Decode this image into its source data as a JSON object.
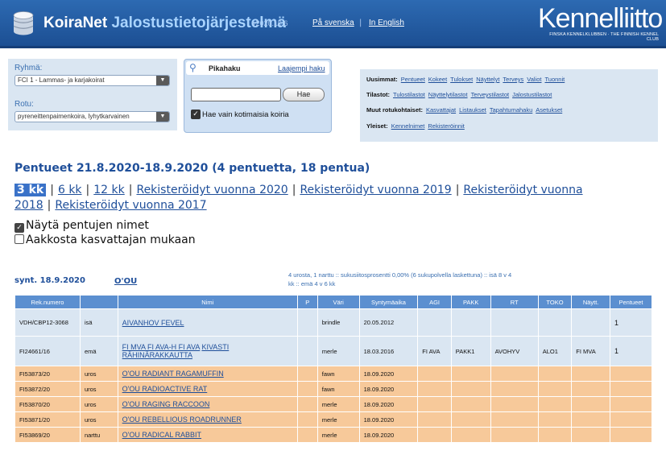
{
  "header": {
    "app_name": "KoiraNet",
    "app_subtitle": "Jalostustietojärjestelmä",
    "version": "v2020.10.6",
    "lang_swedish": "På svenska",
    "lang_separator": "|",
    "lang_english": "In English",
    "logo_text": "Kennelliitto",
    "logo_subtext": "FINSKA KENNELKLUBBEN · THE FINNISH KENNEL CLUB"
  },
  "filters": {
    "group_label": "Ryhmä:",
    "group_value": "FCI 1 - Lammas- ja karjakoirat",
    "breed_label": "Rotu:",
    "breed_value": "pyreneittenpaimenkoira, lyhytkarvainen"
  },
  "quick_search": {
    "title": "Pikahaku",
    "advanced_link": "Laajempi haku",
    "input_value": "",
    "button_label": "Hae",
    "checkbox_label": "Hae vain kotimaisia koiria"
  },
  "quick_links": {
    "rows": [
      {
        "label": "Uusimmat:",
        "links": [
          "Pentueet",
          "Kokeet",
          "Tulokset",
          "Näyttelyt",
          "Terveys",
          "Valiot",
          "Tuonnit"
        ]
      },
      {
        "label": "Tilastot:",
        "links": [
          "Tulostilastot",
          "Näyttelytilastot",
          "Terveystilastot",
          "Jalostustilastot"
        ]
      },
      {
        "label": "Muut rotukohtaiset:",
        "links": [
          "Kasvattajat",
          "Listaukset",
          "Tapahtumahaku",
          "Asetukset"
        ]
      },
      {
        "label": "Yleiset:",
        "links": [
          "Kennelnimet",
          "Rekisteröinnit"
        ]
      }
    ]
  },
  "page": {
    "title": "Pentueet 21.8.2020-18.9.2020 (4 pentuetta, 18 pentua)",
    "periods": [
      "3 kk",
      "6 kk",
      "12 kk",
      "Rekisteröidyt vuonna 2020",
      "Rekisteröidyt vuonna 2019",
      "Rekisteröidyt vuonna 2018",
      "Rekisteröidyt vuonna 2017"
    ],
    "period_separator": "|",
    "option_show_names": "Näytä pentujen nimet",
    "option_show_names_checked": true,
    "option_sort_breeder": "Aakkosta kasvattajan mukaan",
    "option_sort_breeder_checked": false
  },
  "litter": {
    "date": "synt. 18.9.2020",
    "kennel": "O'OU",
    "stats_line1": "4 urosta, 1 narttu  ::  sukusiitosprosentti 0,00% (6 sukupolvella laskettuna)  ::  isä 8 v 4",
    "stats_line2": "kk  ::  emä 4 v 6 kk",
    "columns": [
      "Rek.numero",
      "",
      "Nimi",
      "P",
      "Väri",
      "Syntymäaika",
      "AGI",
      "PAKK",
      "RT",
      "TOKO",
      "Näytt.",
      "Pentueet"
    ],
    "parents": [
      {
        "reg": "VDH/CBP12-3068",
        "role": "isä",
        "titles": "",
        "name": "AIVANHOV FEVEL",
        "p": "",
        "color": "brindle",
        "born": "20.05.2012",
        "agi": "",
        "pakk": "",
        "rt": "",
        "toko": "",
        "shows": "",
        "litters": "1"
      },
      {
        "reg": "FI24661/16",
        "role": "emä",
        "titles": "FI MVA FI AVA-H FI AVA",
        "name": "KIVASTI RÄHINÄRAKKAUTTA",
        "p": "",
        "color": "merle",
        "born": "18.03.2016",
        "agi": "FI AVA",
        "pakk": "PAKK1",
        "rt": "AVOHYV",
        "toko": "ALO1",
        "shows": "FI MVA",
        "litters": "1"
      }
    ],
    "puppies": [
      {
        "reg": "FI53873/20",
        "sex": "uros",
        "name": "O'OU RADIANT RAGAMUFFIN",
        "color": "fawn",
        "born": "18.09.2020"
      },
      {
        "reg": "FI53872/20",
        "sex": "uros",
        "name": "O'OU RADIOACTIVE RAT",
        "color": "fawn",
        "born": "18.09.2020"
      },
      {
        "reg": "FI53870/20",
        "sex": "uros",
        "name": "O'OU RAGING RACCOON",
        "color": "merle",
        "born": "18.09.2020"
      },
      {
        "reg": "FI53871/20",
        "sex": "uros",
        "name": "O'OU REBELLIOUS ROADRUNNER",
        "color": "merle",
        "born": "18.09.2020"
      },
      {
        "reg": "FI53869/20",
        "sex": "narttu",
        "name": "O'OU RADICAL RABBIT",
        "color": "merle",
        "born": "18.09.2020"
      }
    ]
  },
  "colors": {
    "header_blue": "#2d6ab2",
    "panel_blue": "#dae6f2",
    "table_header": "#5b8fd0",
    "puppy_row": "#f7c99a",
    "link": "#1f4f9a"
  }
}
